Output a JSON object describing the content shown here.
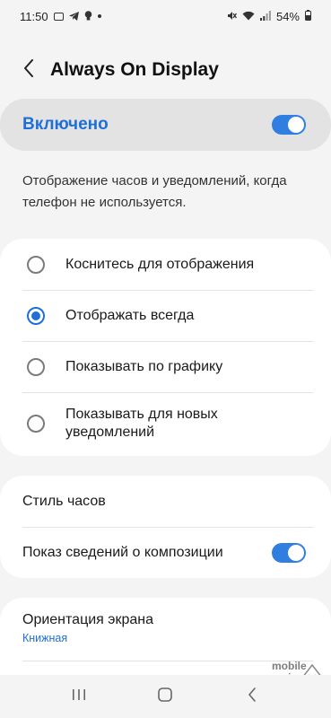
{
  "status_bar": {
    "time": "11:50",
    "battery": "54%",
    "left_icons": [
      "gallery-icon",
      "telegram-icon",
      "lightbulb-icon",
      "dot-icon"
    ],
    "right_icons": [
      "mute-icon",
      "wifi-icon",
      "signal-icon",
      "battery-icon"
    ]
  },
  "header": {
    "title": "Always On Display",
    "back_icon": "back-arrow-icon"
  },
  "master_switch": {
    "label": "Включено",
    "state": "on"
  },
  "description": "Отображение часов и уведомлений, когда телефон не используется.",
  "display_modes": {
    "options": [
      {
        "label": "Коснитесь для отображения",
        "selected": false
      },
      {
        "label": "Отображать всегда",
        "selected": true
      },
      {
        "label": "Показывать по графику",
        "selected": false
      },
      {
        "label": "Показывать для новых уведомлений",
        "selected": false
      }
    ]
  },
  "clock_settings": {
    "clock_style_label": "Стиль часов",
    "music_info_label": "Показ сведений о композиции",
    "music_info_state": "on"
  },
  "orientation": {
    "title": "Ориентация экрана",
    "value": "Книжная"
  },
  "watermark": {
    "line1": "mobile",
    "line2": "review"
  },
  "colors": {
    "accent": "#1f6fd8",
    "background": "#f4f4f4",
    "card": "#ffffff",
    "highlight": "#e3e3e3"
  }
}
